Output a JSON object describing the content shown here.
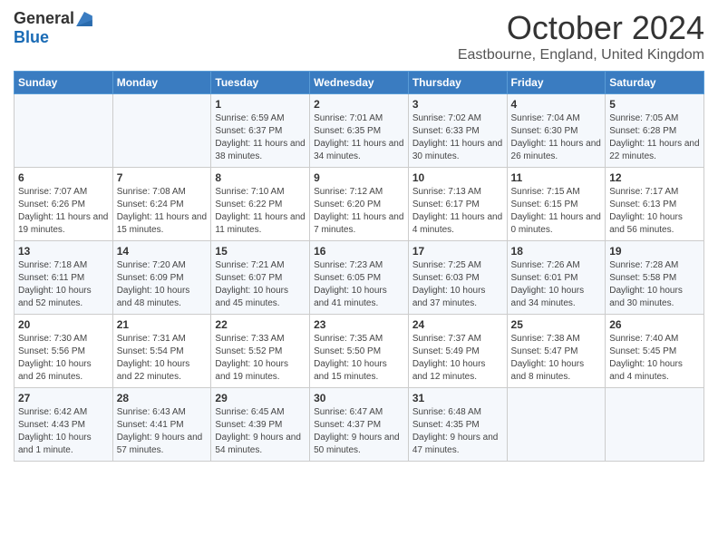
{
  "header": {
    "logo_general": "General",
    "logo_blue": "Blue",
    "month_title": "October 2024",
    "location": "Eastbourne, England, United Kingdom"
  },
  "days_of_week": [
    "Sunday",
    "Monday",
    "Tuesday",
    "Wednesday",
    "Thursday",
    "Friday",
    "Saturday"
  ],
  "weeks": [
    [
      {
        "day": "",
        "content": ""
      },
      {
        "day": "",
        "content": ""
      },
      {
        "day": "1",
        "content": "Sunrise: 6:59 AM\nSunset: 6:37 PM\nDaylight: 11 hours and 38 minutes."
      },
      {
        "day": "2",
        "content": "Sunrise: 7:01 AM\nSunset: 6:35 PM\nDaylight: 11 hours and 34 minutes."
      },
      {
        "day": "3",
        "content": "Sunrise: 7:02 AM\nSunset: 6:33 PM\nDaylight: 11 hours and 30 minutes."
      },
      {
        "day": "4",
        "content": "Sunrise: 7:04 AM\nSunset: 6:30 PM\nDaylight: 11 hours and 26 minutes."
      },
      {
        "day": "5",
        "content": "Sunrise: 7:05 AM\nSunset: 6:28 PM\nDaylight: 11 hours and 22 minutes."
      }
    ],
    [
      {
        "day": "6",
        "content": "Sunrise: 7:07 AM\nSunset: 6:26 PM\nDaylight: 11 hours and 19 minutes."
      },
      {
        "day": "7",
        "content": "Sunrise: 7:08 AM\nSunset: 6:24 PM\nDaylight: 11 hours and 15 minutes."
      },
      {
        "day": "8",
        "content": "Sunrise: 7:10 AM\nSunset: 6:22 PM\nDaylight: 11 hours and 11 minutes."
      },
      {
        "day": "9",
        "content": "Sunrise: 7:12 AM\nSunset: 6:20 PM\nDaylight: 11 hours and 7 minutes."
      },
      {
        "day": "10",
        "content": "Sunrise: 7:13 AM\nSunset: 6:17 PM\nDaylight: 11 hours and 4 minutes."
      },
      {
        "day": "11",
        "content": "Sunrise: 7:15 AM\nSunset: 6:15 PM\nDaylight: 11 hours and 0 minutes."
      },
      {
        "day": "12",
        "content": "Sunrise: 7:17 AM\nSunset: 6:13 PM\nDaylight: 10 hours and 56 minutes."
      }
    ],
    [
      {
        "day": "13",
        "content": "Sunrise: 7:18 AM\nSunset: 6:11 PM\nDaylight: 10 hours and 52 minutes."
      },
      {
        "day": "14",
        "content": "Sunrise: 7:20 AM\nSunset: 6:09 PM\nDaylight: 10 hours and 48 minutes."
      },
      {
        "day": "15",
        "content": "Sunrise: 7:21 AM\nSunset: 6:07 PM\nDaylight: 10 hours and 45 minutes."
      },
      {
        "day": "16",
        "content": "Sunrise: 7:23 AM\nSunset: 6:05 PM\nDaylight: 10 hours and 41 minutes."
      },
      {
        "day": "17",
        "content": "Sunrise: 7:25 AM\nSunset: 6:03 PM\nDaylight: 10 hours and 37 minutes."
      },
      {
        "day": "18",
        "content": "Sunrise: 7:26 AM\nSunset: 6:01 PM\nDaylight: 10 hours and 34 minutes."
      },
      {
        "day": "19",
        "content": "Sunrise: 7:28 AM\nSunset: 5:58 PM\nDaylight: 10 hours and 30 minutes."
      }
    ],
    [
      {
        "day": "20",
        "content": "Sunrise: 7:30 AM\nSunset: 5:56 PM\nDaylight: 10 hours and 26 minutes."
      },
      {
        "day": "21",
        "content": "Sunrise: 7:31 AM\nSunset: 5:54 PM\nDaylight: 10 hours and 22 minutes."
      },
      {
        "day": "22",
        "content": "Sunrise: 7:33 AM\nSunset: 5:52 PM\nDaylight: 10 hours and 19 minutes."
      },
      {
        "day": "23",
        "content": "Sunrise: 7:35 AM\nSunset: 5:50 PM\nDaylight: 10 hours and 15 minutes."
      },
      {
        "day": "24",
        "content": "Sunrise: 7:37 AM\nSunset: 5:49 PM\nDaylight: 10 hours and 12 minutes."
      },
      {
        "day": "25",
        "content": "Sunrise: 7:38 AM\nSunset: 5:47 PM\nDaylight: 10 hours and 8 minutes."
      },
      {
        "day": "26",
        "content": "Sunrise: 7:40 AM\nSunset: 5:45 PM\nDaylight: 10 hours and 4 minutes."
      }
    ],
    [
      {
        "day": "27",
        "content": "Sunrise: 6:42 AM\nSunset: 4:43 PM\nDaylight: 10 hours and 1 minute."
      },
      {
        "day": "28",
        "content": "Sunrise: 6:43 AM\nSunset: 4:41 PM\nDaylight: 9 hours and 57 minutes."
      },
      {
        "day": "29",
        "content": "Sunrise: 6:45 AM\nSunset: 4:39 PM\nDaylight: 9 hours and 54 minutes."
      },
      {
        "day": "30",
        "content": "Sunrise: 6:47 AM\nSunset: 4:37 PM\nDaylight: 9 hours and 50 minutes."
      },
      {
        "day": "31",
        "content": "Sunrise: 6:48 AM\nSunset: 4:35 PM\nDaylight: 9 hours and 47 minutes."
      },
      {
        "day": "",
        "content": ""
      },
      {
        "day": "",
        "content": ""
      }
    ]
  ]
}
